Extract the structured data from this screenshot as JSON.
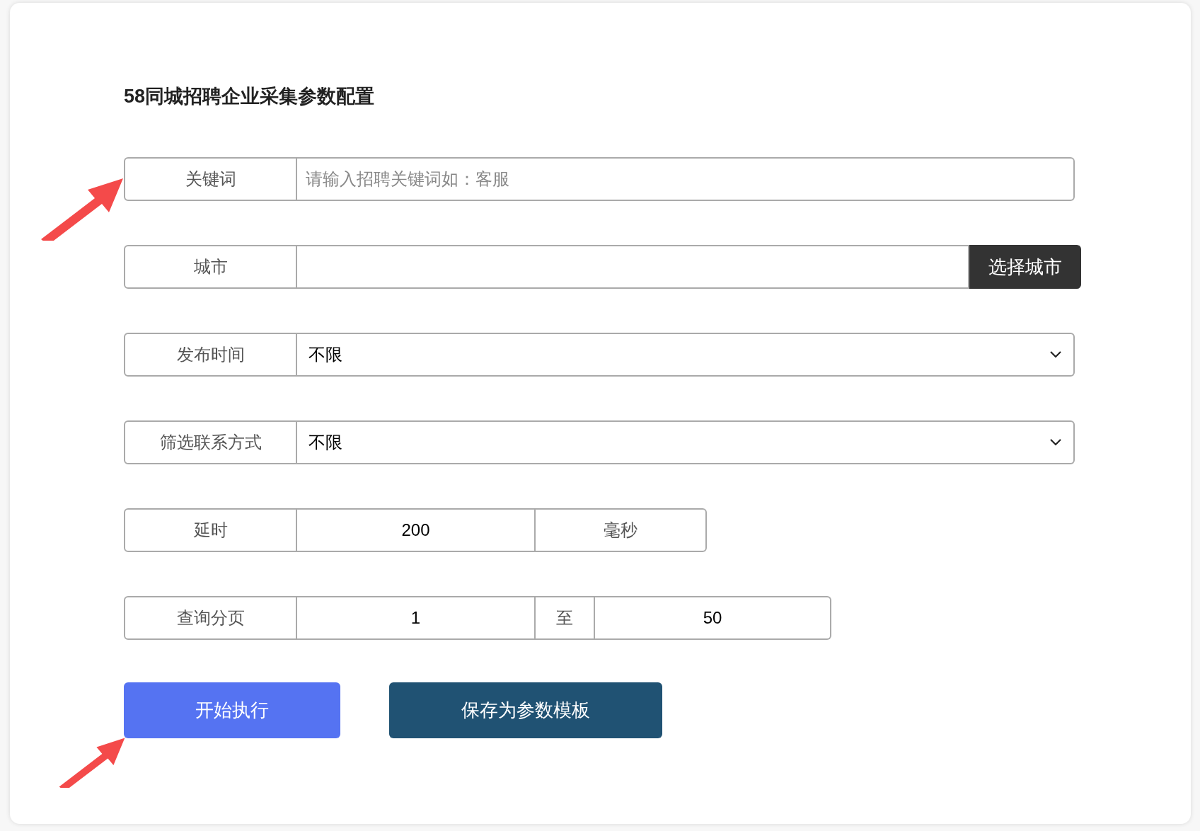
{
  "title": "58同城招聘企业采集参数配置",
  "fields": [
    {
      "kind": "text",
      "label": "关键词",
      "placeholder": "请输入招聘关键词如：客服"
    },
    {
      "kind": "picker",
      "label": "城市",
      "button": "选择城市"
    },
    {
      "kind": "select",
      "label": "发布时间",
      "value": "不限"
    },
    {
      "kind": "select",
      "label": "筛选联系方式",
      "value": "不限"
    },
    {
      "kind": "unit",
      "label": "延时",
      "value": "200",
      "unit": "毫秒"
    },
    {
      "kind": "range",
      "label": "查询分页",
      "from": "1",
      "separator": "至",
      "to": "50"
    }
  ],
  "buttons": [
    {
      "label": "开始执行",
      "kind": "primary"
    },
    {
      "label": "保存为参数模板",
      "kind": "secondary"
    }
  ]
}
